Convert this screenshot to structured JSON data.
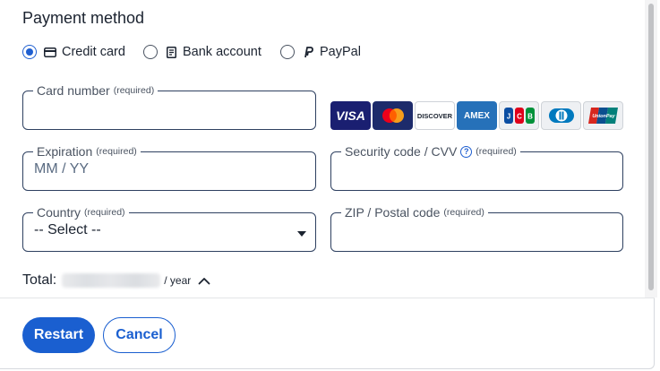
{
  "section": {
    "title": "Payment method"
  },
  "payment_methods": [
    {
      "label": "Credit card",
      "icon": "credit-card-icon",
      "selected": true
    },
    {
      "label": "Bank account",
      "icon": "bank-icon",
      "selected": false
    },
    {
      "label": "PayPal",
      "icon": "paypal-icon",
      "selected": false
    }
  ],
  "fields": {
    "card_number": {
      "label": "Card number",
      "required": "(required)",
      "value": ""
    },
    "expiration": {
      "label": "Expiration",
      "required": "(required)",
      "placeholder": "MM / YY"
    },
    "cvv": {
      "label": "Security code / CVV",
      "required": "(required)",
      "help_icon": "help-icon"
    },
    "country": {
      "label": "Country",
      "required": "(required)",
      "value": "-- Select --"
    },
    "zip": {
      "label": "ZIP / Postal code",
      "required": "(required)",
      "value": ""
    }
  },
  "card_brands": {
    "visa": "VISA",
    "mastercard": "mastercard-logo",
    "discover": "DISCOVER",
    "amex": "AMEX",
    "jcb": "jcb-logo",
    "diners": "diners-logo",
    "unionpay": "unionpay-logo"
  },
  "total": {
    "label": "Total:",
    "period": "/ year",
    "toggle_icon": "chevron-up-icon"
  },
  "buttons": {
    "restart": "Restart",
    "cancel": "Cancel"
  },
  "colors": {
    "accent": "#1a5fd0",
    "text": "#1b2330",
    "border": "#2e4060"
  }
}
